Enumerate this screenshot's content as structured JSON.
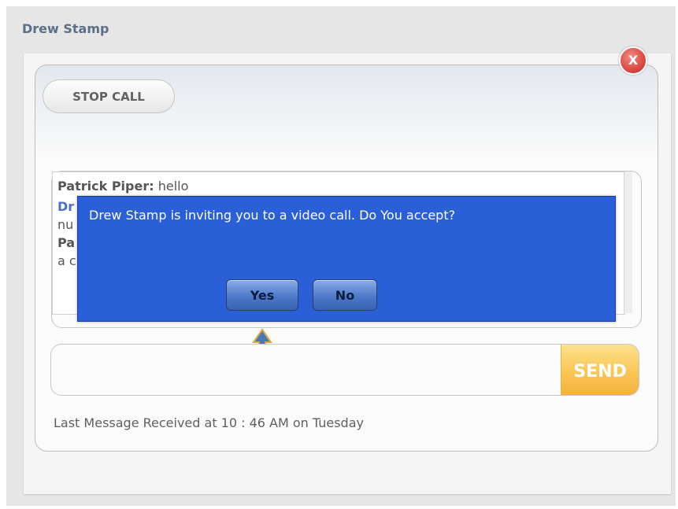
{
  "window": {
    "title": "Drew Stamp"
  },
  "call": {
    "stop_label": "STOP CALL",
    "close_label": "X"
  },
  "messages": [
    {
      "sender": "Patrick Piper:",
      "text": " hello"
    },
    {
      "sender": "Dr",
      "text": ""
    },
    {
      "sender": "",
      "text": "nu"
    },
    {
      "sender": "Pa",
      "text": ""
    },
    {
      "sender": "",
      "text": "a c"
    }
  ],
  "dialog": {
    "text": "Drew Stamp is inviting you to a video call. Do You accept?",
    "yes_label": "Yes",
    "no_label": "No"
  },
  "composer": {
    "placeholder": "",
    "send_label": "SEND"
  },
  "status": {
    "last_message": "Last Message Received at 10 : 46 AM on Tuesday"
  },
  "colors": {
    "dialog_bg": "#2a5fd8",
    "send_bg": "#f9c656",
    "close_bg": "#d9453d",
    "sender_blue": "#4a6fd0"
  },
  "icons": {
    "close": "close-icon",
    "pointer": "up-arrow-icon"
  }
}
